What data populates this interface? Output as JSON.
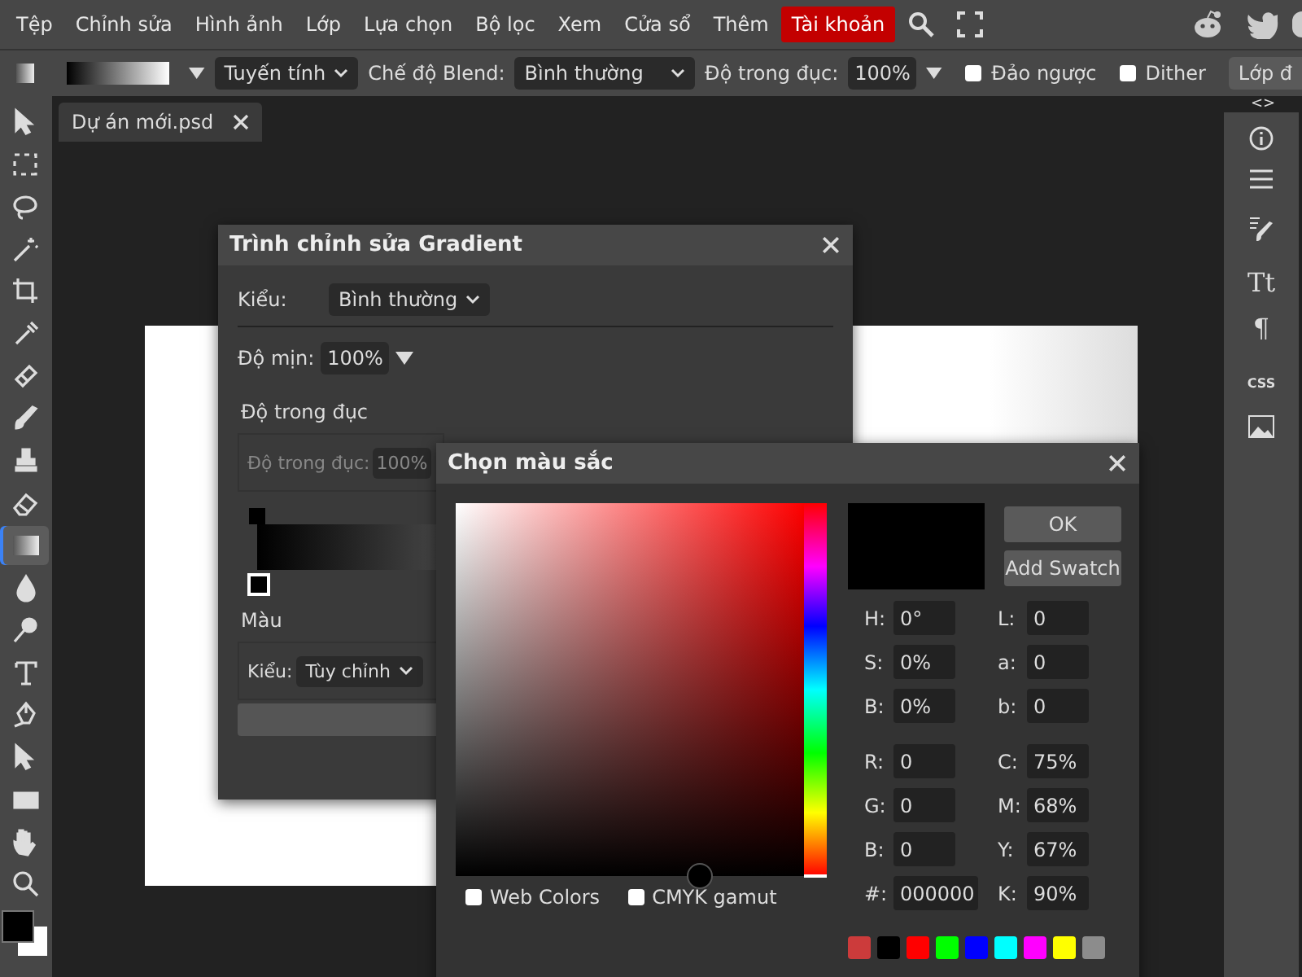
{
  "menu": [
    {
      "label": "Tệp",
      "highlighted": false
    },
    {
      "label": "Chỉnh sửa",
      "highlighted": false
    },
    {
      "label": "Hình ảnh",
      "highlighted": false
    },
    {
      "label": "Lớp",
      "highlighted": false
    },
    {
      "label": "Lựa chọn",
      "highlighted": false
    },
    {
      "label": "Bộ lọc",
      "highlighted": false
    },
    {
      "label": "Xem",
      "highlighted": false
    },
    {
      "label": "Cửa sổ",
      "highlighted": false
    },
    {
      "label": "Thêm",
      "highlighted": false
    },
    {
      "label": "Tài khoản",
      "highlighted": true
    }
  ],
  "options_bar": {
    "gradient_type": "Tuyến tính",
    "blend_label": "Chế độ Blend:",
    "blend_value": "Bình thường",
    "opacity_label": "Độ trong đục:",
    "opacity_value": "100%",
    "checkboxes": [
      {
        "label": "Đảo ngược",
        "checked": false
      },
      {
        "label": "Dither",
        "checked": false
      }
    ],
    "layer_button": "Lớp đ"
  },
  "tools": [
    {
      "kind": "move",
      "selected": false
    },
    {
      "kind": "marquee",
      "selected": false
    },
    {
      "kind": "lasso",
      "selected": false
    },
    {
      "kind": "wand",
      "selected": false
    },
    {
      "kind": "crop",
      "selected": false
    },
    {
      "kind": "eyedropper",
      "selected": false
    },
    {
      "kind": "heal",
      "selected": false
    },
    {
      "kind": "brush",
      "selected": false
    },
    {
      "kind": "stamp",
      "selected": false
    },
    {
      "kind": "eraser",
      "selected": false
    },
    {
      "kind": "gradient",
      "selected": true
    },
    {
      "kind": "drop",
      "selected": false
    },
    {
      "kind": "dodge",
      "selected": false
    },
    {
      "kind": "type",
      "selected": false
    },
    {
      "kind": "pen",
      "selected": false
    },
    {
      "kind": "select",
      "selected": false
    },
    {
      "kind": "shape",
      "selected": false
    },
    {
      "kind": "hand",
      "selected": false
    },
    {
      "kind": "zoom",
      "selected": false
    }
  ],
  "document_tab": {
    "title": "Dự án mới.psd"
  },
  "right_panel": {
    "toggle": "<>",
    "items": [
      {
        "kind": "info"
      },
      {
        "kind": "lines"
      },
      {
        "kind": "brush"
      },
      {
        "kind": "char",
        "text": "Tt"
      },
      {
        "kind": "char",
        "text": "¶"
      },
      {
        "kind": "char",
        "text": "CSS"
      },
      {
        "kind": "image"
      }
    ]
  },
  "gradient_editor": {
    "title": "Trình chỉnh sửa Gradient",
    "type_label": "Kiểu:",
    "type_value": "Bình thường",
    "smooth_label": "Độ mịn:",
    "smooth_value": "100%",
    "opacity_heading": "Độ trong đục",
    "stop_opacity_label": "Độ trong đục:",
    "stop_opacity_value": "100%",
    "color_heading": "Màu",
    "color_type_label": "Kiểu:",
    "color_type_value": "Tùy chỉnh"
  },
  "color_picker": {
    "title": "Chọn màu sắc",
    "ok": "OK",
    "add_swatch": "Add Swatch",
    "hue_slider": {
      "level": 0
    },
    "hsb_fields": [
      {
        "label": "H:",
        "value": "0°"
      },
      {
        "label": "S:",
        "value": "0%"
      },
      {
        "label": "B:",
        "value": "0%"
      }
    ],
    "lab_fields": [
      {
        "label": "L:",
        "value": "0"
      },
      {
        "label": "a:",
        "value": "0"
      },
      {
        "label": "b:",
        "value": "0"
      }
    ],
    "rgb_fields": [
      {
        "label": "R:",
        "value": "0"
      },
      {
        "label": "G:",
        "value": "0"
      },
      {
        "label": "B:",
        "value": "0"
      },
      {
        "label": "#:",
        "value": "000000"
      }
    ],
    "cmyk_fields": [
      {
        "label": "C:",
        "value": "75%"
      },
      {
        "label": "M:",
        "value": "68%"
      },
      {
        "label": "Y:",
        "value": "67%"
      },
      {
        "label": "K:",
        "value": "90%"
      }
    ],
    "checkboxes": [
      {
        "label": "Web Colors",
        "checked": false
      },
      {
        "label": "CMYK gamut",
        "checked": false
      }
    ],
    "swatches": [
      {
        "color": "#cc3b3b"
      },
      {
        "color": "#000000"
      },
      {
        "color": "#ff0000"
      },
      {
        "color": "#00ff00"
      },
      {
        "color": "#0000ff"
      },
      {
        "color": "#00ffff"
      },
      {
        "color": "#ff00ff"
      },
      {
        "color": "#ffff00"
      },
      {
        "color": "#8c8c8c"
      }
    ]
  }
}
